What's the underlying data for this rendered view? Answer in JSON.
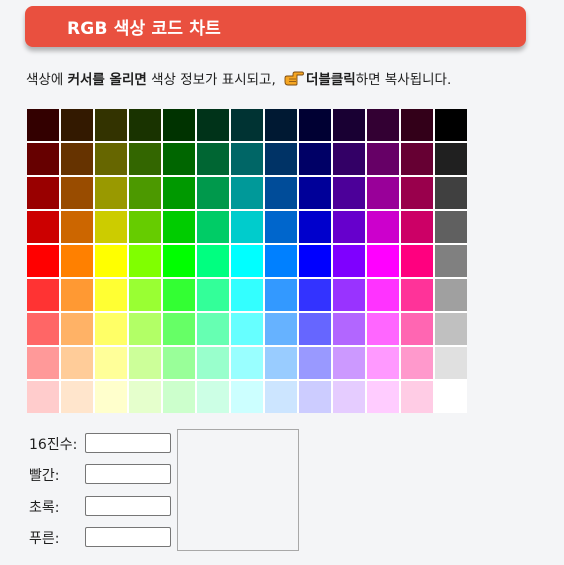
{
  "header": {
    "title": "RGB 색상 코드 차트",
    "accent_color": "#e9503f"
  },
  "instruction": {
    "part1": "색상에 ",
    "bold1": "커서를 올리면",
    "part2": " 색상 정보가 표시되고, ",
    "icon": "pointing-hand-icon",
    "bold2": "더블클릭",
    "part3": "하면 복사됩니다."
  },
  "palette": {
    "columns": 13,
    "rows": [
      [
        "#330000",
        "#331900",
        "#333300",
        "#193300",
        "#003300",
        "#003319",
        "#003333",
        "#001933",
        "#000033",
        "#190033",
        "#330033",
        "#330019",
        "#000000"
      ],
      [
        "#660000",
        "#663300",
        "#666600",
        "#336600",
        "#006600",
        "#006633",
        "#006666",
        "#003366",
        "#000066",
        "#330066",
        "#660066",
        "#660033",
        "#202020"
      ],
      [
        "#990000",
        "#994c00",
        "#999900",
        "#4c9900",
        "#009900",
        "#00994c",
        "#009999",
        "#004c99",
        "#000099",
        "#4c0099",
        "#990099",
        "#99004c",
        "#404040"
      ],
      [
        "#cc0000",
        "#cc6600",
        "#cccc00",
        "#66cc00",
        "#00cc00",
        "#00cc66",
        "#00cccc",
        "#0066cc",
        "#0000cc",
        "#6600cc",
        "#cc00cc",
        "#cc0066",
        "#606060"
      ],
      [
        "#ff0000",
        "#ff8000",
        "#ffff00",
        "#80ff00",
        "#00ff00",
        "#00ff80",
        "#00ffff",
        "#0080ff",
        "#0000ff",
        "#7f00ff",
        "#ff00ff",
        "#ff007f",
        "#808080"
      ],
      [
        "#ff3333",
        "#ff9933",
        "#ffff33",
        "#99ff33",
        "#33ff33",
        "#33ff99",
        "#33ffff",
        "#3399ff",
        "#3333ff",
        "#9933ff",
        "#ff33ff",
        "#ff3399",
        "#a0a0a0"
      ],
      [
        "#ff6666",
        "#ffb266",
        "#ffff66",
        "#b2ff66",
        "#66ff66",
        "#66ffb2",
        "#66ffff",
        "#66b2ff",
        "#6666ff",
        "#b266ff",
        "#ff66ff",
        "#ff66b2",
        "#c0c0c0"
      ],
      [
        "#ff9999",
        "#ffcc99",
        "#ffff99",
        "#ccff99",
        "#99ff99",
        "#99ffcc",
        "#99ffff",
        "#99ccff",
        "#9999ff",
        "#cc99ff",
        "#ff99ff",
        "#ff99cc",
        "#e0e0e0"
      ],
      [
        "#ffcccc",
        "#ffe5cc",
        "#ffffcc",
        "#e5ffcc",
        "#ccffcc",
        "#ccffe5",
        "#ccffff",
        "#cce5ff",
        "#ccccff",
        "#e5ccff",
        "#ffccff",
        "#ffcce5",
        "#ffffff"
      ]
    ]
  },
  "form": {
    "hex_label": "16진수:",
    "hex_value": "",
    "red_label": "빨간:",
    "red_value": "",
    "green_label": "초록:",
    "green_value": "",
    "blue_label": "푸른:",
    "blue_value": ""
  }
}
